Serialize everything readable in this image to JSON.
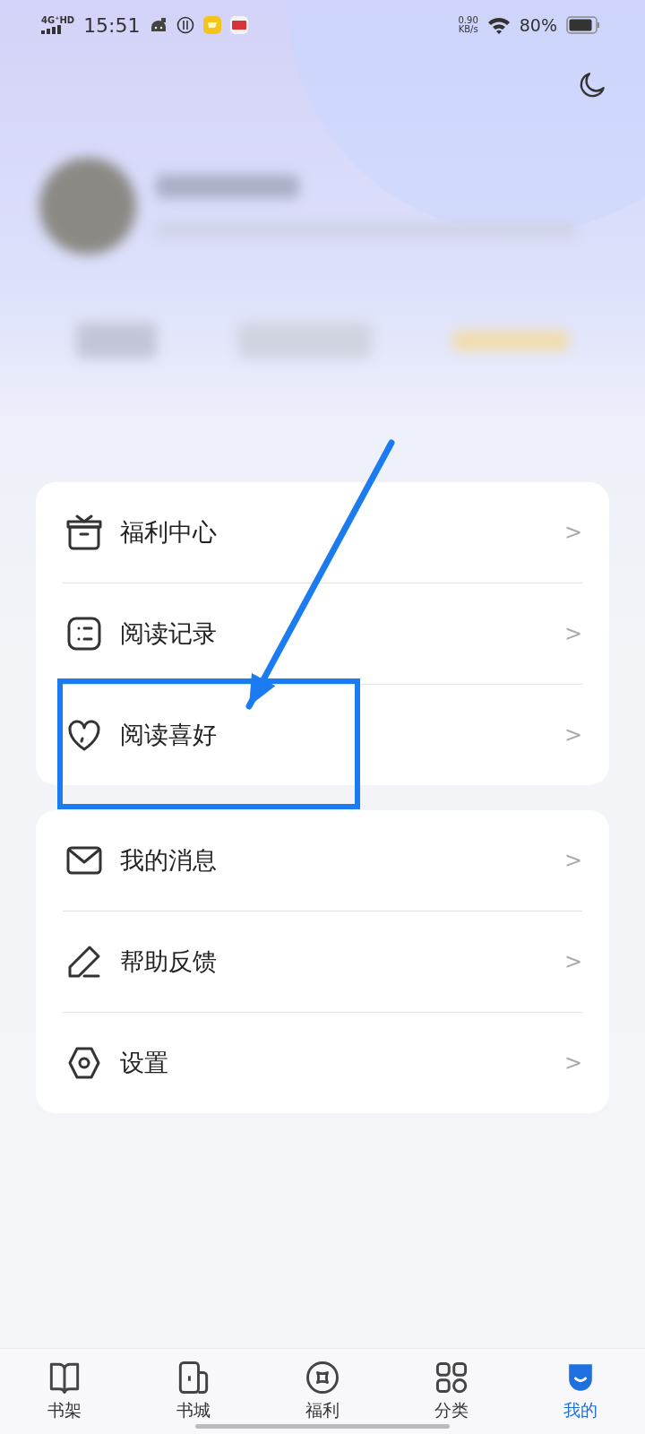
{
  "status_bar": {
    "network": "4G⁺HD",
    "time": "15:51",
    "speed_value": "0.90",
    "speed_unit": "KB/s",
    "battery": "80%"
  },
  "menu_groups": [
    {
      "items": [
        {
          "label": "福利中心",
          "chevron": ">"
        },
        {
          "label": "阅读记录",
          "chevron": ">"
        },
        {
          "label": "阅读喜好",
          "chevron": ">"
        }
      ]
    },
    {
      "items": [
        {
          "label": "我的消息",
          "chevron": ">"
        },
        {
          "label": "帮助反馈",
          "chevron": ">"
        },
        {
          "label": "设置",
          "chevron": ">"
        }
      ]
    }
  ],
  "tab_bar": [
    {
      "label": "书架",
      "selected": false
    },
    {
      "label": "书城",
      "selected": false
    },
    {
      "label": "福利",
      "selected": false
    },
    {
      "label": "分类",
      "selected": false
    },
    {
      "label": "我的",
      "selected": true
    }
  ]
}
